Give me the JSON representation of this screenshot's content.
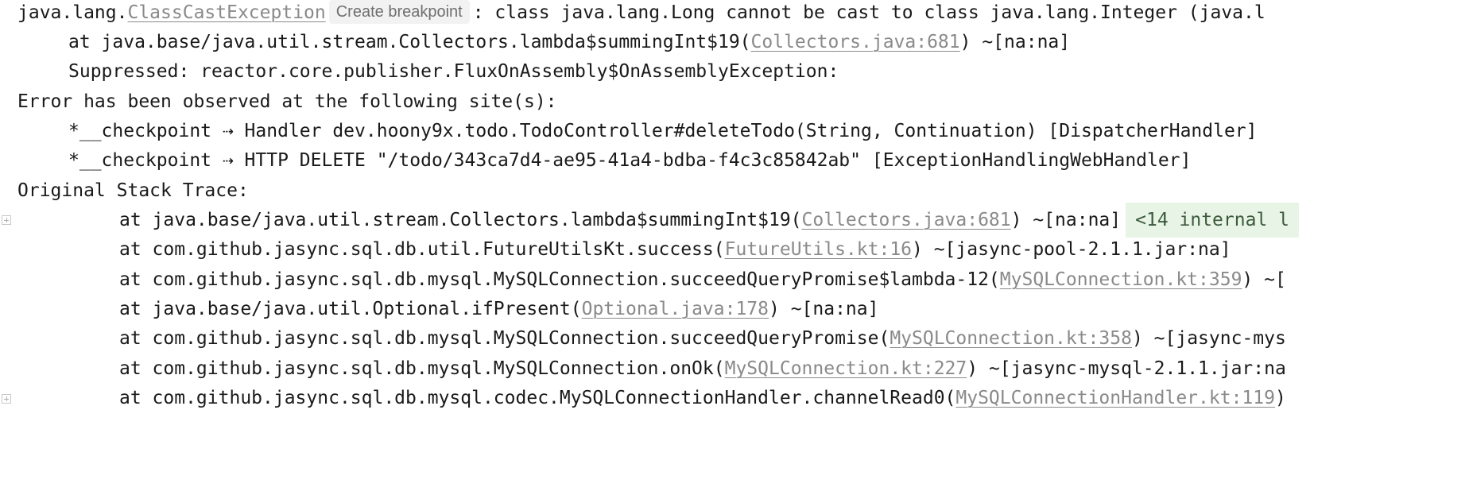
{
  "console": {
    "exception_line": {
      "prefix": "java.lang.",
      "exception_link": "ClassCastException",
      "breakpoint_chip": "Create breakpoint",
      "message": ": class java.lang.Long cannot be cast to class java.lang.Integer (java.l"
    },
    "first_frame": {
      "prefix": "at java.base/java.util.stream.Collectors.lambda$summingInt$19(",
      "link": "Collectors.java:681",
      "suffix": ") ~[na:na]"
    },
    "suppressed": "Suppressed: reactor.core.publisher.FluxOnAssembly$OnAssemblyException:",
    "observed_header": "Error has been observed at the following site(s):",
    "checkpoints": [
      "*__checkpoint ⇢ Handler dev.hoony9x.todo.TodoController#deleteTodo(String, Continuation) [DispatcherHandler]",
      "*__checkpoint ⇢ HTTP DELETE \"/todo/343ca7d4-ae95-41a4-bdba-f4c3c85842ab\" [ExceptionHandlingWebHandler]"
    ],
    "original_header": "Original Stack Trace:",
    "frames": [
      {
        "prefix": "at java.base/java.util.stream.Collectors.lambda$summingInt$19(",
        "link": "Collectors.java:681",
        "suffix": ") ~[na:na]",
        "internal": "<14 internal l"
      },
      {
        "prefix": "at com.github.jasync.sql.db.util.FutureUtilsKt.success(",
        "link": "FutureUtils.kt:16",
        "suffix": ") ~[jasync-pool-2.1.1.jar:na]"
      },
      {
        "prefix": "at com.github.jasync.sql.db.mysql.MySQLConnection.succeedQueryPromise$lambda-12(",
        "link": "MySQLConnection.kt:359",
        "suffix": ") ~["
      },
      {
        "prefix": "at java.base/java.util.Optional.ifPresent(",
        "link": "Optional.java:178",
        "suffix": ") ~[na:na]"
      },
      {
        "prefix": "at com.github.jasync.sql.db.mysql.MySQLConnection.succeedQueryPromise(",
        "link": "MySQLConnection.kt:358",
        "suffix": ") ~[jasync-mys"
      },
      {
        "prefix": "at com.github.jasync.sql.db.mysql.MySQLConnection.onOk(",
        "link": "MySQLConnection.kt:227",
        "suffix": ") ~[jasync-mysql-2.1.1.jar:na"
      },
      {
        "prefix": "at com.github.jasync.sql.db.mysql.codec.MySQLConnectionHandler.channelRead0(",
        "link": "MySQLConnectionHandler.kt:119",
        "suffix": ")"
      }
    ]
  }
}
